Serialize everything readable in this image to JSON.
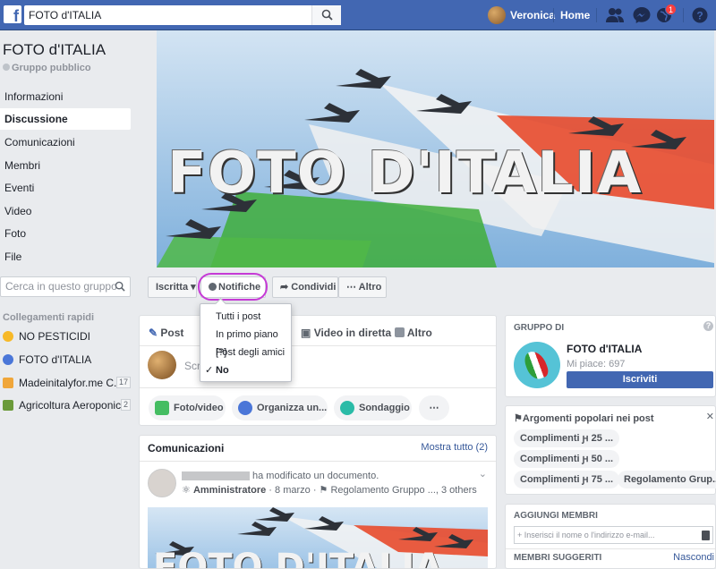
{
  "topbar": {
    "search_value": "FOTO d'ITALIA",
    "user_name": "Veronica",
    "home_label": "Home",
    "notif_count": "1"
  },
  "group": {
    "title": "FOTO d'ITALIA",
    "privacy": "Gruppo pubblico",
    "nav": [
      "Informazioni",
      "Discussione",
      "Comunicazioni",
      "Membri",
      "Eventi",
      "Video",
      "Foto",
      "File"
    ],
    "search_placeholder": "Cerca in questo gruppo",
    "quick_links_title": "Collegamenti rapidi",
    "quick_links": [
      {
        "label": "NO PESTICIDI",
        "count": ""
      },
      {
        "label": "FOTO d'ITALIA",
        "count": ""
      },
      {
        "label": "Madeinitalyfor.me C...",
        "count": "17"
      },
      {
        "label": "Agricoltura Aeroponica",
        "count": "2"
      }
    ]
  },
  "cover": {
    "text": "FOTO D'ITALIA"
  },
  "actions": {
    "joined": "Iscritta",
    "notifications": "Notifiche",
    "share": "Condividi",
    "more": "Altro"
  },
  "notif_menu": {
    "items": [
      "Tutti i post",
      "In primo piano [?]",
      "Post degli amici",
      "No"
    ],
    "checked_index": 3
  },
  "composer": {
    "tabs": [
      "Post",
      "Video in diretta",
      "Altro"
    ],
    "placeholder": "Scri",
    "buttons": [
      "Foto/video",
      "Organizza un...",
      "Sondaggio",
      "⋯"
    ]
  },
  "announcements": {
    "title": "Comunicazioni",
    "show_all": "Mostra tutto (2)",
    "post_action": "ha modificato un documento.",
    "role": "Amministratore",
    "date": "8 marzo",
    "doc": "Regolamento Gruppo ...",
    "others": ", 3 others"
  },
  "sidebar_right": {
    "group_of_label": "GRUPPO DI",
    "page_name": "FOTO d'ITALIA",
    "likes": "Mi piace: 697",
    "subscribe": "Iscriviti",
    "topics_title": "Argomenti popolari nei post",
    "topics": [
      "Complimenti ԩ 25 ...",
      "Complimenti ԩ 50 ...",
      "Complimenti ԩ 75 ...",
      "Regolamento Grup..."
    ],
    "add_members_title": "AGGIUNGI MEMBRI",
    "add_members_placeholder": "Inserisci il nome o l'indirizzo e-mail...",
    "suggested_title": "MEMBRI SUGGERITI",
    "hide": "Nascondi"
  },
  "colors": {
    "brand": "#4267b2",
    "highlight_ring": "#c63bd6",
    "badge": "#fa3e3e"
  }
}
